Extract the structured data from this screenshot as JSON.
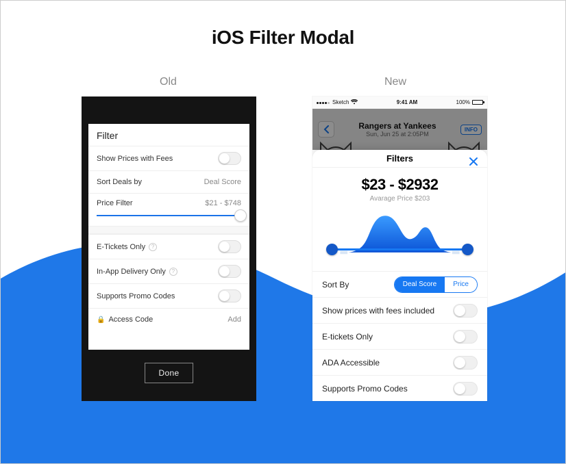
{
  "page_title": "iOS Filter Modal",
  "columns": {
    "old_label": "Old",
    "new_label": "New"
  },
  "old": {
    "header": "Filter",
    "rows": {
      "show_prices": "Show Prices with Fees",
      "sort_label": "Sort Deals by",
      "sort_value": "Deal Score",
      "price_filter_label": "Price Filter",
      "price_filter_value": "$21 - $748",
      "etickets": "E-Tickets Only",
      "inapp": "In-App Delivery Only",
      "promo": "Supports Promo Codes",
      "access_code": "Access Code",
      "access_code_action": "Add"
    },
    "done": "Done"
  },
  "new": {
    "status": {
      "carrier": "Sketch",
      "time": "9:41 AM",
      "battery": "100%"
    },
    "nav": {
      "title": "Rangers at Yankees",
      "subtitle": "Sun, Jun 25 at 2:05PM",
      "info": "INFO"
    },
    "sheet_title": "Filters",
    "price_range": "$23 - $2932",
    "avg_price": "Avarage Price $203",
    "sort_label": "Sort By",
    "seg": {
      "deal": "Deal Score",
      "price": "Price"
    },
    "rows": {
      "show_prices": "Show prices with fees included",
      "etickets": "E-tickets Only",
      "ada": "ADA Accessible",
      "promo": "Supports Promo Codes"
    }
  },
  "colors": {
    "blue": "#1778F2",
    "wave": "#1f78e8"
  }
}
